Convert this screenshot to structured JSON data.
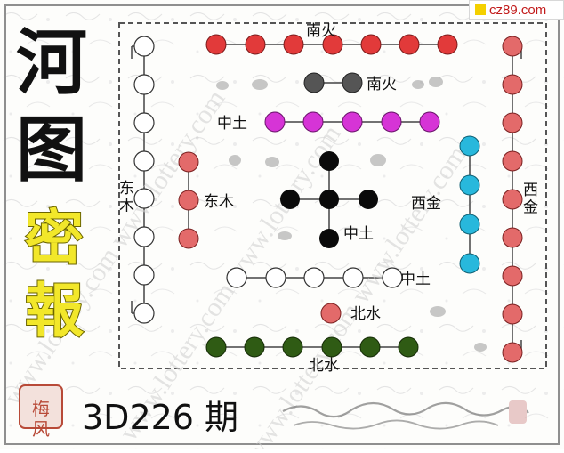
{
  "site_tag": "cz89.com",
  "title": {
    "chars": [
      "河",
      "图"
    ]
  },
  "subtitle": {
    "chars": [
      "密",
      "報"
    ]
  },
  "seal": "梅风",
  "footer": {
    "issue_text": "3D226 期",
    "trail_text": ""
  },
  "watermark": "www.lottery.com",
  "labels": {
    "south_fire_top": "南火",
    "south_fire_inner": "南火",
    "center_earth_1": "中土",
    "center_earth_2": "中土",
    "center_earth_3": "中土",
    "east_wood_outer": "东木",
    "east_wood_inner": "东木",
    "west_metal_inner": "西金",
    "west_metal_outer": "西金",
    "north_water_inner": "北水",
    "north_water_outer": "北水"
  },
  "colors": {
    "red": "#e23a3a",
    "salmon": "#e36a6a",
    "magenta": "#d634d6",
    "cyan": "#28b8dc",
    "green": "#2f5b14",
    "black": "#0a0a0a",
    "dark_gray": "#555555",
    "title_black": "#111111",
    "subtitle_yellow": "#f2e72a",
    "seal_red": "#b84a38",
    "site_accent": "#f4d000"
  }
}
